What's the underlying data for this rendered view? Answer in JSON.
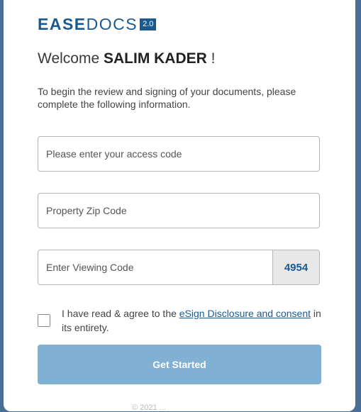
{
  "logo": {
    "ease": "EASE",
    "docs": "DOCS",
    "version": "2.0"
  },
  "welcome": {
    "prefix": "Welcome ",
    "name": "SALIM KADER",
    "suffix": " !"
  },
  "intro": "To begin the review and signing of your documents, please complete the following information.",
  "fields": {
    "access_code_placeholder": "Please enter your access code",
    "zip_placeholder": "Property Zip Code",
    "viewing_code_placeholder": "Enter Viewing Code",
    "viewing_code_value": "4954"
  },
  "consent": {
    "before": "I have read & agree to the ",
    "link": "eSign Disclosure and consent",
    "after": " in its entirety."
  },
  "button": {
    "label": "Get Started"
  },
  "footer": "© 2021 ..."
}
